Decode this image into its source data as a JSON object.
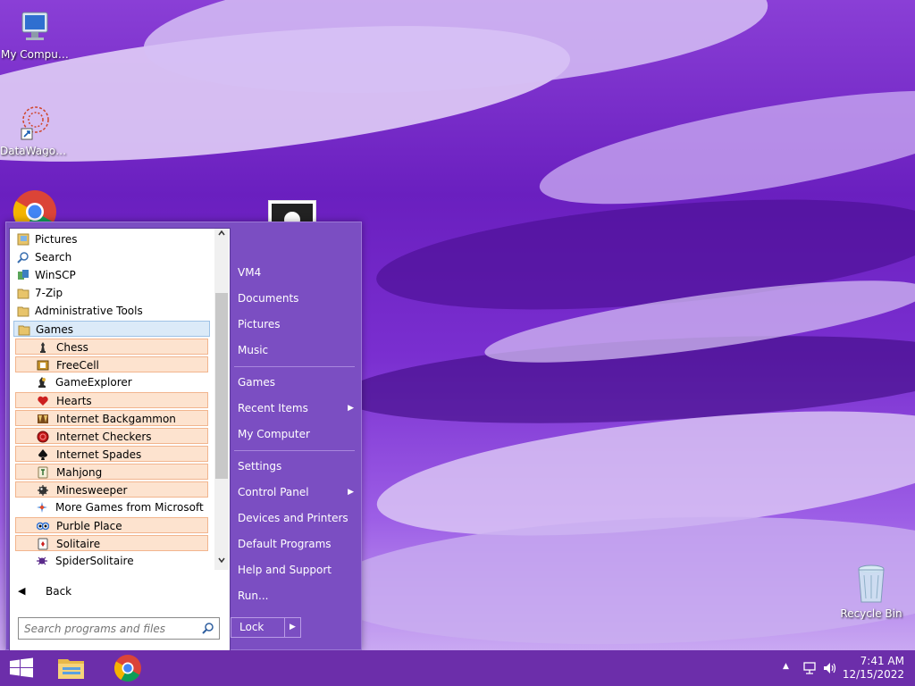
{
  "desktop": {
    "icons": [
      {
        "label": "My Computer",
        "icon": "my-computer-icon"
      },
      {
        "label": "DataWagon...",
        "icon": "datawagon-icon"
      },
      {
        "label": "",
        "icon": "chrome-icon"
      },
      {
        "label": "Recycle Bin",
        "icon": "recycle-bin-icon"
      }
    ]
  },
  "start_menu": {
    "programs": [
      {
        "label": "Pictures",
        "icon": "pictures-folder-icon"
      },
      {
        "label": "Search",
        "icon": "search-icon"
      },
      {
        "label": "WinSCP",
        "icon": "winscp-icon"
      },
      {
        "label": "7-Zip",
        "icon": "folder-icon"
      },
      {
        "label": "Administrative Tools",
        "icon": "folder-icon"
      },
      {
        "label": "Games",
        "icon": "folder-icon"
      },
      {
        "label": "Chess",
        "icon": "chess-icon"
      },
      {
        "label": "FreeCell",
        "icon": "freecell-icon"
      },
      {
        "label": "GameExplorer",
        "icon": "game-explorer-icon"
      },
      {
        "label": "Hearts",
        "icon": "hearts-icon"
      },
      {
        "label": "Internet Backgammon",
        "icon": "backgammon-icon"
      },
      {
        "label": "Internet Checkers",
        "icon": "checkers-icon"
      },
      {
        "label": "Internet Spades",
        "icon": "spades-icon"
      },
      {
        "label": "Mahjong",
        "icon": "mahjong-icon"
      },
      {
        "label": "Minesweeper",
        "icon": "minesweeper-icon"
      },
      {
        "label": "More Games from Microsoft",
        "icon": "more-games-icon"
      },
      {
        "label": "Purble Place",
        "icon": "purble-place-icon"
      },
      {
        "label": "Solitaire",
        "icon": "solitaire-icon"
      },
      {
        "label": "SpiderSolitaire",
        "icon": "spider-solitaire-icon"
      }
    ],
    "back_label": "Back",
    "search_placeholder": "Search programs and files",
    "right_items": [
      {
        "label": "VM4"
      },
      {
        "label": "Documents"
      },
      {
        "label": "Pictures"
      },
      {
        "label": "Music"
      },
      {
        "label": "Games"
      },
      {
        "label": "Recent Items"
      },
      {
        "label": "My Computer"
      },
      {
        "label": "Settings"
      },
      {
        "label": "Control Panel"
      },
      {
        "label": "Devices and Printers"
      },
      {
        "label": "Default Programs"
      },
      {
        "label": "Help and Support"
      },
      {
        "label": "Run..."
      }
    ],
    "lock_label": "Lock"
  },
  "taskbar": {
    "time": "7:41 AM",
    "date": "12/15/2022"
  },
  "colors": {
    "taskbar": "#6c2eaa",
    "start_menu_bg": "#7b4ec2",
    "highlight_orange": "#fde3cf",
    "highlight_blue": "#dbeaf8"
  }
}
